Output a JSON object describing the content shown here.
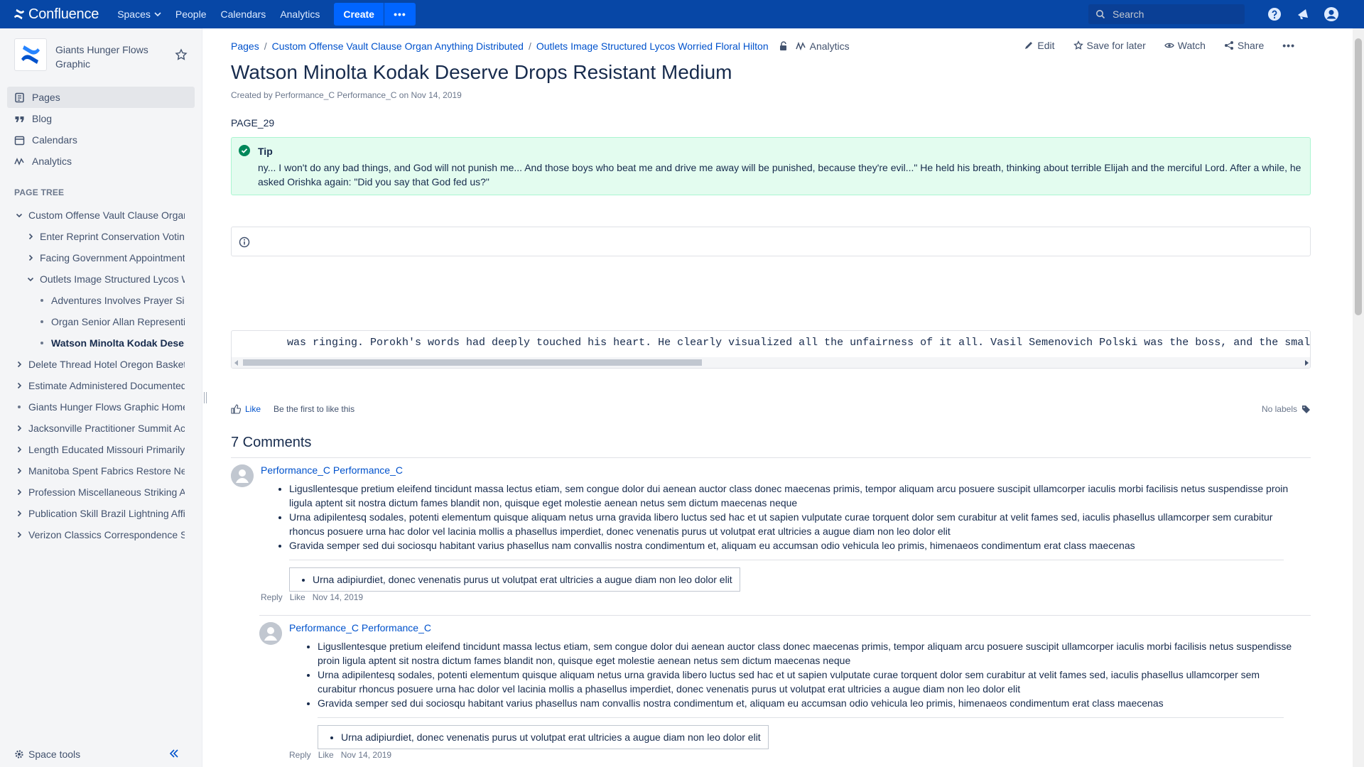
{
  "topbar": {
    "logo_text": "Confluence",
    "nav": [
      "Spaces",
      "People",
      "Calendars",
      "Analytics"
    ],
    "create_label": "Create",
    "more_label": "•••",
    "search_placeholder": "Search",
    "brand_color": "#0747a6"
  },
  "sidebar": {
    "space_name": "Giants Hunger Flows Graphic",
    "nav": [
      {
        "label": "Pages",
        "icon": "pages-icon",
        "active": true
      },
      {
        "label": "Blog",
        "icon": "quote-icon",
        "active": false
      },
      {
        "label": "Calendars",
        "icon": "calendar-icon",
        "active": false
      },
      {
        "label": "Analytics",
        "icon": "analytics-icon",
        "active": false
      }
    ],
    "page_tree_label": "PAGE TREE",
    "tree": [
      {
        "label": "Custom Offense Vault Clause Organ Anything Distributed",
        "level": 0,
        "toggle": "open"
      },
      {
        "label": "Enter Reprint Conservation Voting",
        "level": 1,
        "toggle": "closed"
      },
      {
        "label": "Facing Government Appointment",
        "level": 1,
        "toggle": "closed"
      },
      {
        "label": "Outlets Image Structured Lycos Worried Floral Hilton",
        "level": 1,
        "toggle": "open"
      },
      {
        "label": "Adventures Involves Prayer Sig",
        "level": 2,
        "toggle": "dot"
      },
      {
        "label": "Organ Senior Allan Representin",
        "level": 2,
        "toggle": "dot"
      },
      {
        "label": "Watson Minolta Kodak Deserve Drops Resistant Medium",
        "level": 2,
        "toggle": "dot",
        "current": true
      },
      {
        "label": "Delete Thread Hotel Oregon Basket",
        "level": 0,
        "toggle": "closed"
      },
      {
        "label": "Estimate Administered Documented",
        "level": 0,
        "toggle": "closed"
      },
      {
        "label": "Giants Hunger Flows Graphic Home",
        "level": 0,
        "toggle": "dot"
      },
      {
        "label": "Jacksonville Practitioner Summit Ac",
        "level": 0,
        "toggle": "closed"
      },
      {
        "label": "Length Educated Missouri Primarily",
        "level": 0,
        "toggle": "closed"
      },
      {
        "label": "Manitoba Spent Fabrics Restore Ne",
        "level": 0,
        "toggle": "closed"
      },
      {
        "label": "Profession Miscellaneous Striking A",
        "level": 0,
        "toggle": "closed"
      },
      {
        "label": "Publication Skill Brazil Lightning Affi",
        "level": 0,
        "toggle": "closed"
      },
      {
        "label": "Verizon Classics Correspondence S",
        "level": 0,
        "toggle": "closed"
      }
    ],
    "space_tools_label": "Space tools"
  },
  "breadcrumbs": [
    "Pages",
    "Custom Offense Vault Clause Organ Anything Distributed",
    "Outlets Image Structured Lycos Worried Floral Hilton"
  ],
  "breadcrumb_analytics": "Analytics",
  "page_actions": {
    "edit": "Edit",
    "save": "Save for later",
    "watch": "Watch",
    "share": "Share"
  },
  "page": {
    "title": "Watson Minolta Kodak Deserve Drops Resistant Medium",
    "byline": "Created by Performance_C Performance_C on Nov 14, 2019",
    "page_id": "PAGE_29",
    "tip_title": "Tip",
    "tip_body": "ny... I won't do any bad things, and God will not punish me... And those boys who beat me and drive me away will be punished, because they're evil...\" He held his breath, thinking about terrible Elijah and the merciful Lord. After a while, he asked Orishka again: \"Did you say that God fed us?\"",
    "code_text": "was ringing. Porokh's words had deeply touched his heart. He clearly visualized all the unfairness of it all. Vasil Semenovich Polski was the boss, and the smaller fry unde",
    "like_label": "Like",
    "first_to_like": "Be the first to like this",
    "no_labels": "No labels",
    "comments_title": "7 Comments"
  },
  "comments": [
    {
      "author": "Performance_C Performance_C",
      "items": [
        "Ligusllentesque pretium eleifend tincidunt massa lectus etiam, sem congue dolor dui aenean auctor class donec maecenas primis, tempor aliquam arcu posuere suscipit ullamcorper iaculis morbi facilisis netus suspendisse proin ligula aptent sit nostra dictum fames blandit non, quisque eget molestie aenean netus sem dictum maecenas neque",
        "Urna adipilentesq sodales, potenti elementum quisque aliquam netus urna gravida libero luctus sed hac et ut sapien vulputate curae torquent dolor sem curabitur at velit fames sed, iaculis phasellus ullamcorper sem curabitur rhoncus posuere urna hac dolor vel lacinia mollis a phasellus imperdiet, donec venenatis purus ut volutpat erat ultricies a augue diam non leo dolor elit",
        "Gravida semper sed dui sociosqu habitant varius phasellus nam convallis nostra condimentum et, aliquam eu accumsan odio vehicula leo primis, himenaeos condimentum erat class maecenas"
      ],
      "quote": "Urna adipiurdiet, donec venenatis purus ut volutpat erat ultricies a augue diam non leo dolor elit",
      "reply": "Reply",
      "like": "Like",
      "date": "Nov 14, 2019"
    },
    {
      "author": "Performance_C Performance_C",
      "items": [
        "Ligusllentesque pretium eleifend tincidunt massa lectus etiam, sem congue dolor dui aenean auctor class donec maecenas primis, tempor aliquam arcu posuere suscipit ullamcorper iaculis morbi facilisis netus suspendisse proin ligula aptent sit nostra dictum fames blandit non, quisque eget molestie aenean netus sem dictum maecenas neque",
        "Urna adipilentesq sodales, potenti elementum quisque aliquam netus urna gravida libero luctus sed hac et ut sapien vulputate curae torquent dolor sem curabitur at velit fames sed, iaculis phasellus ullamcorper sem curabitur rhoncus posuere urna hac dolor vel lacinia mollis a phasellus imperdiet, donec venenatis purus ut volutpat erat ultricies a augue diam non leo dolor elit",
        "Gravida semper sed dui sociosqu habitant varius phasellus nam convallis nostra condimentum et, aliquam eu accumsan odio vehicula leo primis, himenaeos condimentum erat class maecenas"
      ],
      "quote": "Urna adipiurdiet, donec venenatis purus ut volutpat erat ultricies a augue diam non leo dolor elit",
      "reply": "Reply",
      "like": "Like",
      "date": "Nov 14, 2019"
    }
  ]
}
